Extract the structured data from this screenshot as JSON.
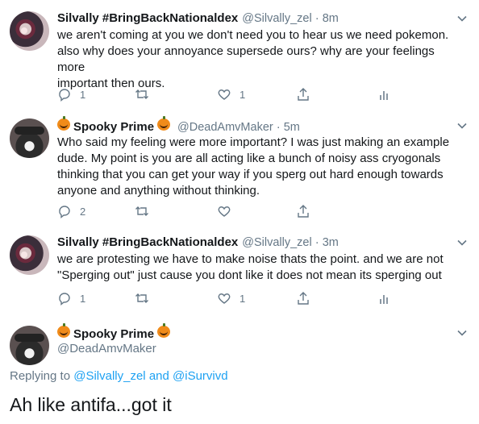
{
  "tweets": [
    {
      "name": "Silvally #BringBackNationaldex",
      "handle": "@Silvally_zel",
      "time": "8m",
      "text_lines": [
        "we aren't coming at you we don't need you to hear us we need pokemon.",
        "also why does your annoyance supersede ours? why are your feelings more",
        "important then ours."
      ],
      "replies": "1",
      "retweets": "",
      "likes": "1"
    },
    {
      "name": "Spooky Prime",
      "handle": "@DeadAmvMaker",
      "time": "5m",
      "text_lines": [
        "Who said my feeling were more important? I was just making an example",
        "dude. My point is you are all acting like a bunch of noisy ass cryogonals",
        "thinking that you can get your way if you sperg out hard enough towards",
        "anyone and anything without thinking."
      ],
      "replies": "2",
      "retweets": "",
      "likes": ""
    },
    {
      "name": "Silvally #BringBackNationaldex",
      "handle": "@Silvally_zel",
      "time": "3m",
      "text_lines": [
        "we are protesting we have to make noise thats the point. and we are not",
        "\"Sperging out\" just cause you dont like it does not mean its sperging out"
      ],
      "replies": "1",
      "retweets": "",
      "likes": "1"
    }
  ],
  "focused": {
    "name": "Spooky Prime",
    "handle": "@DeadAmvMaker",
    "replying_prefix": "Replying to",
    "reply_user_1": "@Silvally_zel",
    "reply_and": "and",
    "reply_user_2": "@iSurvivd",
    "text": "Ah like antifa...got it"
  },
  "icons": {
    "reply": "reply-icon",
    "retweet": "retweet-icon",
    "like": "heart-icon",
    "share": "share-icon",
    "analytics": "analytics-icon",
    "more": "chevron-down-icon",
    "emoji": "pumpkin-emoji"
  },
  "colors": {
    "text": "#14171a",
    "muted": "#657786",
    "link": "#1da1f2",
    "pumpkin": "#f08b1a"
  }
}
